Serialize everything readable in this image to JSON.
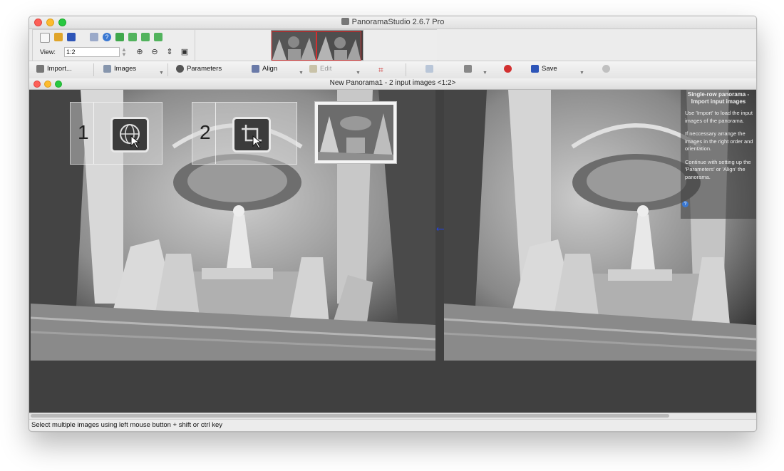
{
  "app": {
    "title": "PanoramaStudio 2.6.7 Pro"
  },
  "view": {
    "label": "View:",
    "value": "1:2"
  },
  "toolbar": {
    "import": "Import...",
    "images": "Images",
    "parameters": "Parameters",
    "align": "Align",
    "edit": "Edit",
    "save": "Save"
  },
  "document": {
    "title": "New Panorama1 - 2 input images <1:2>"
  },
  "steps": [
    {
      "number": "1",
      "icon": "sphere-grid-icon"
    },
    {
      "number": "2",
      "icon": "crop-icon"
    }
  ],
  "help": {
    "title_line1": "Single-row panorama -",
    "title_line2": "Import input images",
    "p1": "Use 'Import' to load the input images of the panorama.",
    "p2": "If neccessary arrange the images in the right order and orientation.",
    "p3": "Continue with setting up the 'Parameters' or 'Align' the panorama."
  },
  "status": {
    "text": "Select multiple images using left mouse button + shift or ctrl key"
  },
  "colors": {
    "accent_red": "#d23030",
    "dark_bg": "#404040"
  }
}
